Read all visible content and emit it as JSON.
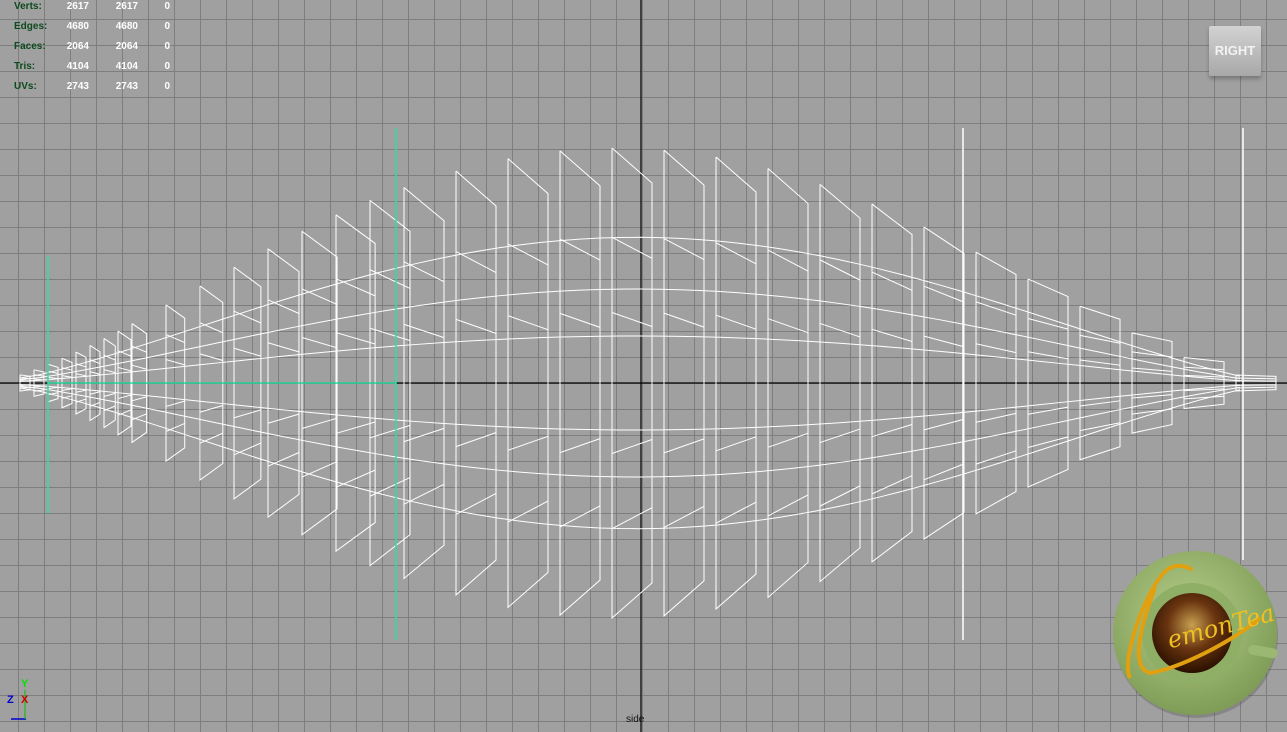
{
  "stats": [
    {
      "label": "Verts:",
      "total": "2617",
      "selected": "2617",
      "extra": "0"
    },
    {
      "label": "Edges:",
      "total": "4680",
      "selected": "4680",
      "extra": "0"
    },
    {
      "label": "Faces:",
      "total": "2064",
      "selected": "2064",
      "extra": "0"
    },
    {
      "label": "Tris:",
      "total": "4104",
      "selected": "4104",
      "extra": "0"
    },
    {
      "label": "UVs:",
      "total": "2743",
      "selected": "2743",
      "extra": "0"
    }
  ],
  "view_cube_label": "RIGHT",
  "camera_label": "side",
  "axes": {
    "y": "Y",
    "z": "Z",
    "x": "X"
  },
  "logo_text": "LemonTea",
  "colors": {
    "grid_bg": "#a0a0a0",
    "grid_line": "#7e7e7e",
    "wire": "#ffffff",
    "manip": "#2ee0a0",
    "axis": "#000000"
  }
}
